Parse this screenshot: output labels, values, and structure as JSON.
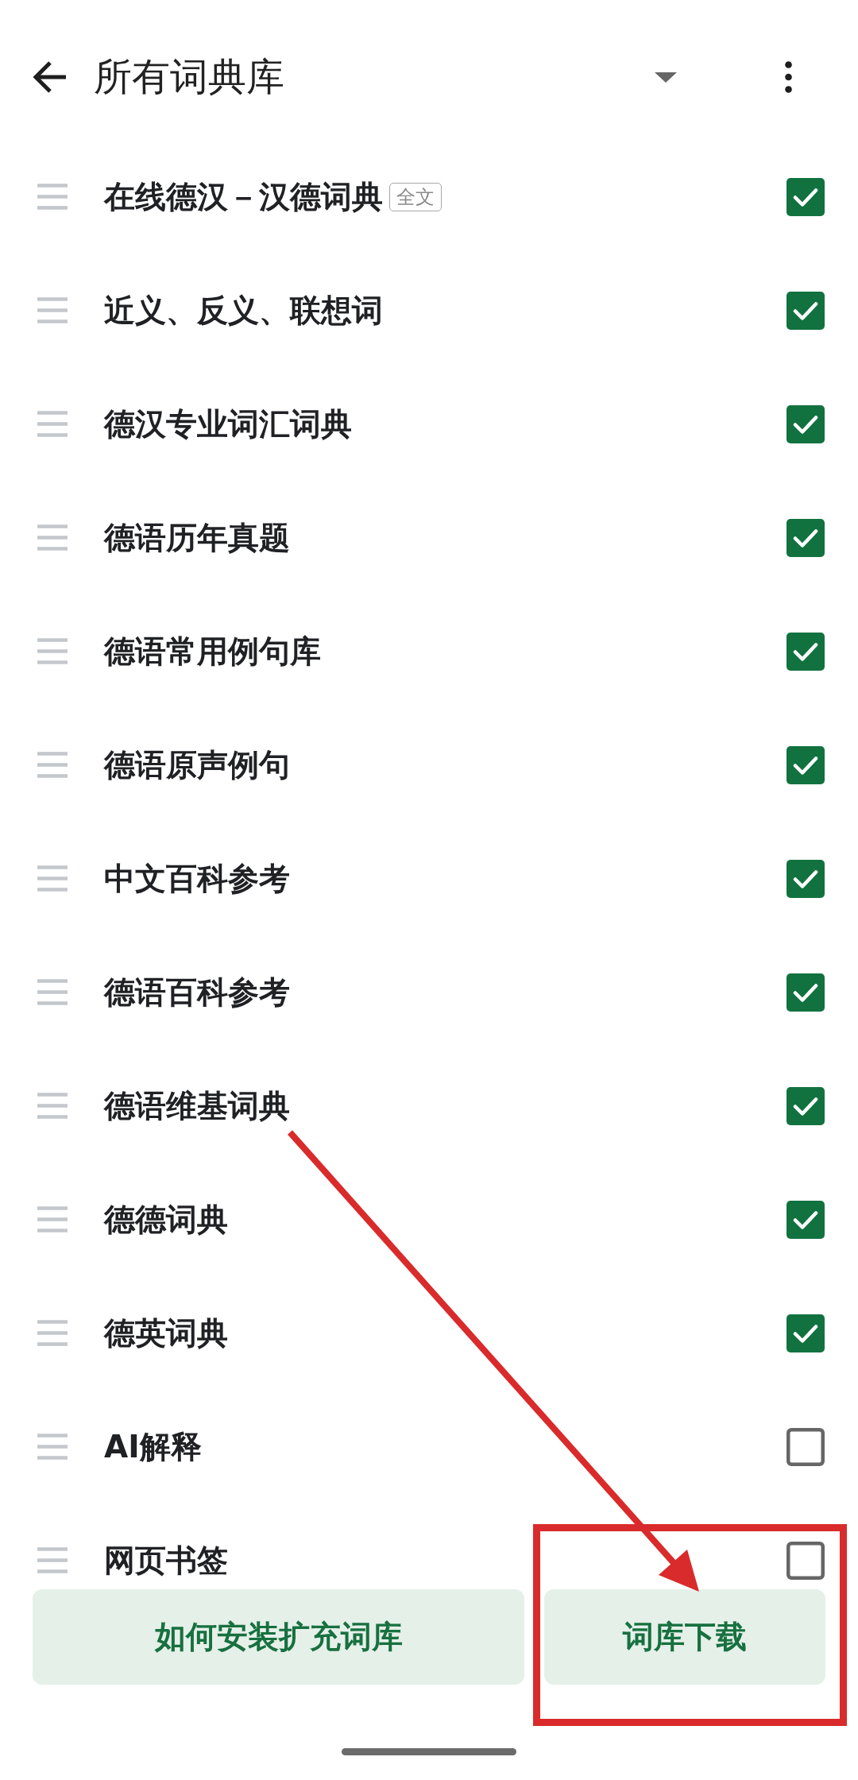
{
  "header": {
    "title": "所有词典库"
  },
  "dictionaries": [
    {
      "name": "在线德汉－汉德词典",
      "tag": "全文",
      "checked": true
    },
    {
      "name": "近义、反义、联想词",
      "checked": true
    },
    {
      "name": "德汉专业词汇词典",
      "checked": true
    },
    {
      "name": "德语历年真题",
      "checked": true
    },
    {
      "name": "德语常用例句库",
      "checked": true
    },
    {
      "name": "德语原声例句",
      "checked": true
    },
    {
      "name": "中文百科参考",
      "checked": true
    },
    {
      "name": "德语百科参考",
      "checked": true
    },
    {
      "name": "德语维基词典",
      "checked": true
    },
    {
      "name": "德德词典",
      "checked": true
    },
    {
      "name": "德英词典",
      "checked": true
    },
    {
      "name": "AI解释",
      "checked": false
    },
    {
      "name": "网页书签",
      "checked": false
    }
  ],
  "buttons": [
    {
      "label": "如何安装扩充词库"
    },
    {
      "label": "词库下载"
    }
  ]
}
